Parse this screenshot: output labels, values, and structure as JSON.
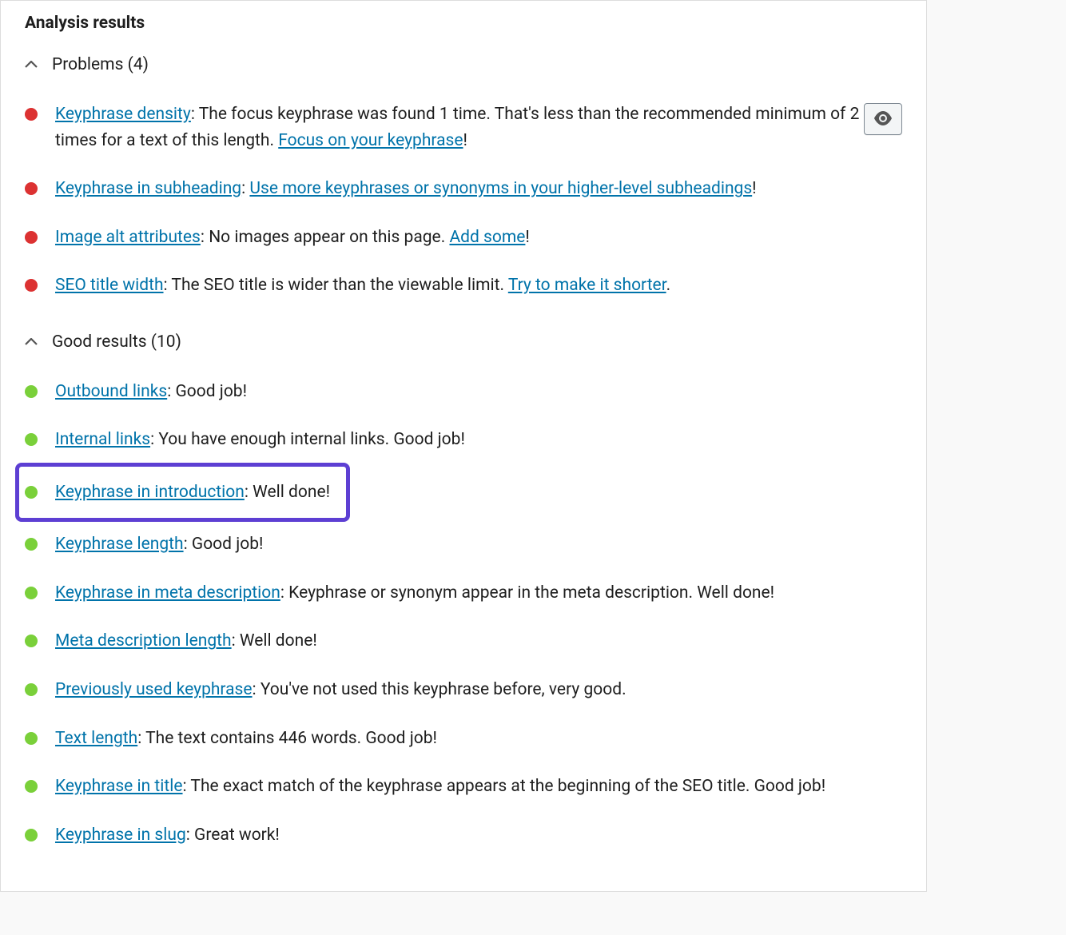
{
  "title": "Analysis results",
  "sections": {
    "problems": {
      "label": "Problems (4)",
      "items": [
        {
          "link": "Keyphrase density",
          "text_before": "",
          "text_mid": ": The focus keyphrase was found 1 time. That's less than the recommended minimum of 2 times for a text of this length. ",
          "action_link": "Focus on your keyphrase",
          "text_after": "!"
        },
        {
          "link": "Keyphrase in subheading",
          "text_before": "",
          "text_mid": ": ",
          "action_link": "Use more keyphrases or synonyms in your higher-level subheadings",
          "text_after": "!"
        },
        {
          "link": "Image alt attributes",
          "text_before": "",
          "text_mid": ": No images appear on this page. ",
          "action_link": "Add some",
          "text_after": "!"
        },
        {
          "link": "SEO title width",
          "text_before": "",
          "text_mid": ": The SEO title is wider than the viewable limit. ",
          "action_link": "Try to make it shorter",
          "text_after": "."
        }
      ]
    },
    "good": {
      "label": "Good results (10)",
      "items": [
        {
          "link": "Outbound links",
          "text_mid": ": Good job!",
          "action_link": "",
          "text_after": ""
        },
        {
          "link": "Internal links",
          "text_mid": ": You have enough internal links. Good job!",
          "action_link": "",
          "text_after": ""
        },
        {
          "link": "Keyphrase in introduction",
          "text_mid": ": Well done!",
          "action_link": "",
          "text_after": "",
          "highlighted": true
        },
        {
          "link": "Keyphrase length",
          "text_mid": ": Good job!",
          "action_link": "",
          "text_after": ""
        },
        {
          "link": "Keyphrase in meta description",
          "text_mid": ": Keyphrase or synonym appear in the meta description. Well done!",
          "action_link": "",
          "text_after": ""
        },
        {
          "link": "Meta description length",
          "text_mid": ": Well done!",
          "action_link": "",
          "text_after": ""
        },
        {
          "link": "Previously used keyphrase",
          "text_mid": ": You've not used this keyphrase before, very good.",
          "action_link": "",
          "text_after": ""
        },
        {
          "link": "Text length",
          "text_mid": ": The text contains 446 words. Good job!",
          "action_link": "",
          "text_after": ""
        },
        {
          "link": "Keyphrase in title",
          "text_mid": ": The exact match of the keyphrase appears at the beginning of the SEO title. Good job!",
          "action_link": "",
          "text_after": ""
        },
        {
          "link": "Keyphrase in slug",
          "text_mid": ": Great work!",
          "action_link": "",
          "text_after": ""
        }
      ]
    }
  }
}
